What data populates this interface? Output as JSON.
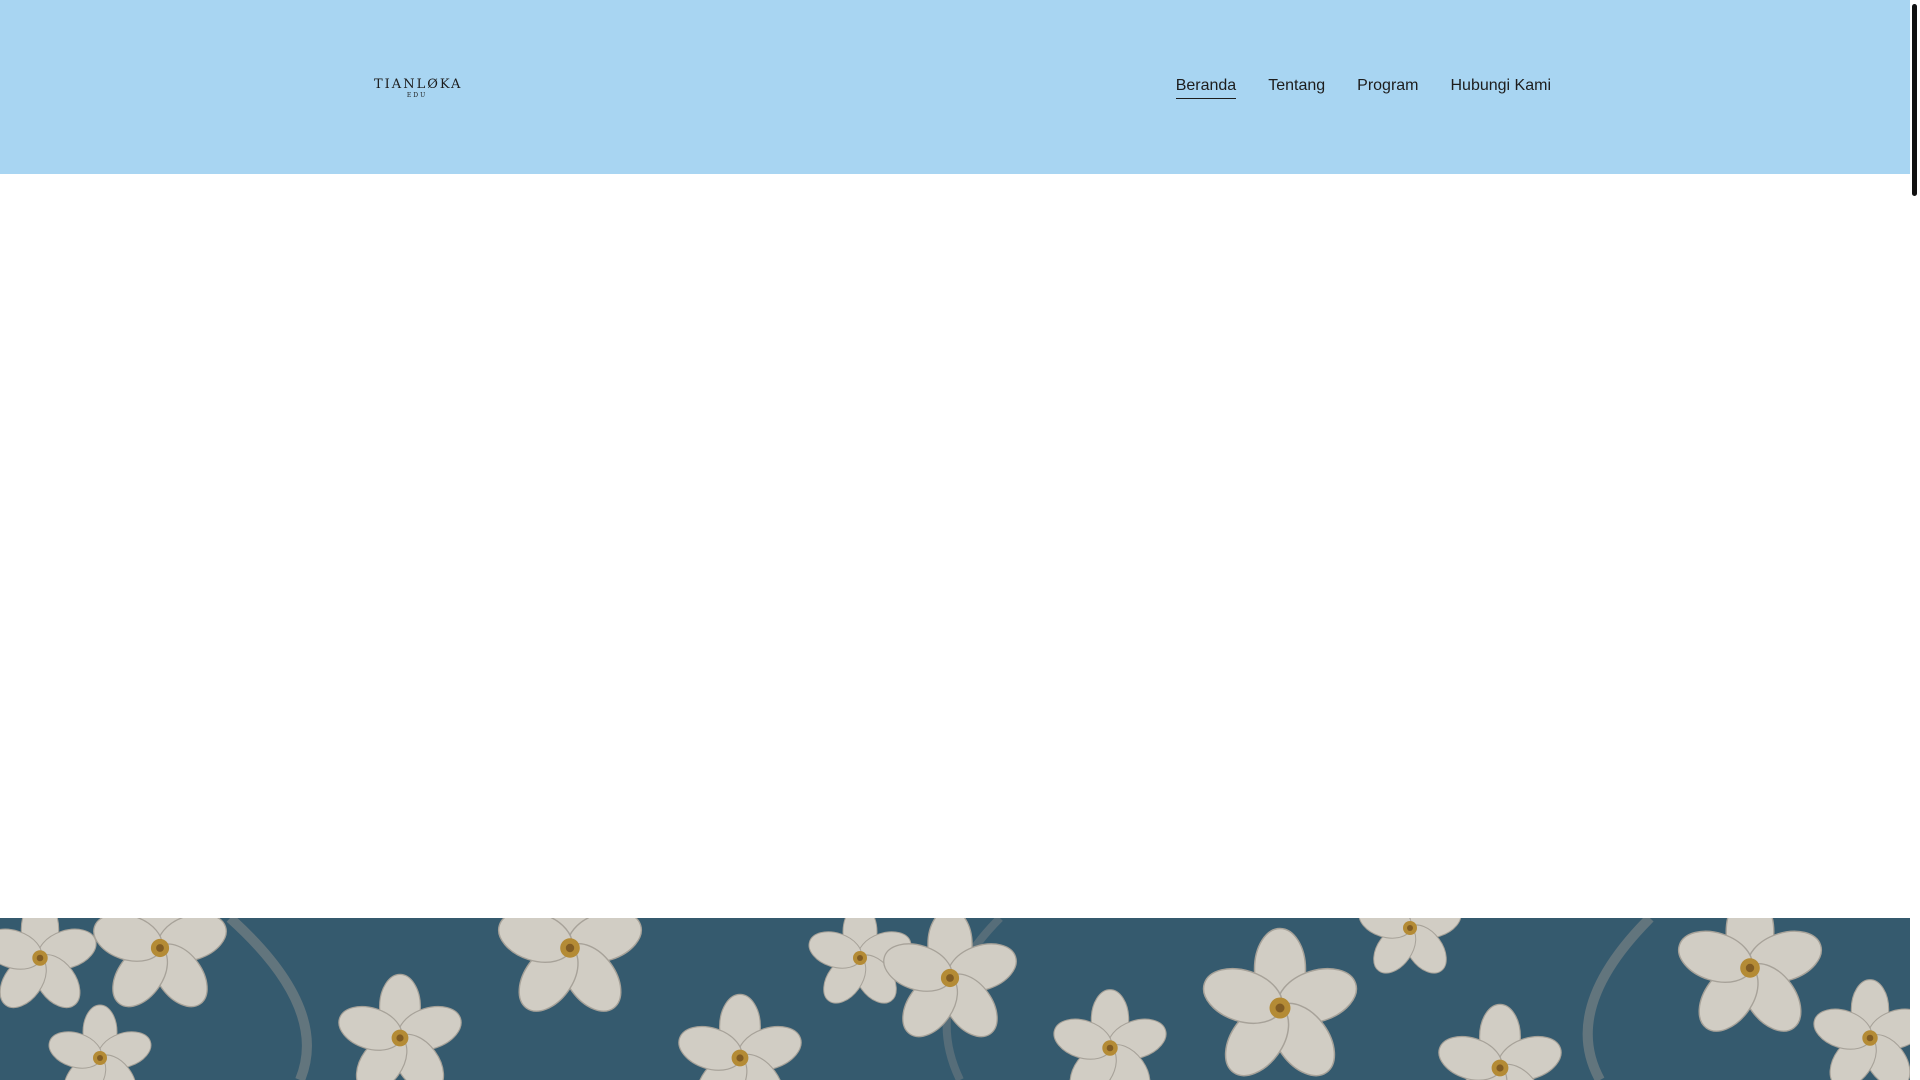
{
  "brand": {
    "logo_main": "TIANLØKA",
    "logo_sub": "EDU"
  },
  "nav": {
    "items": [
      {
        "label": "Beranda",
        "active": true
      },
      {
        "label": "Tentang",
        "active": false
      },
      {
        "label": "Program",
        "active": false
      },
      {
        "label": "Hubungi Kami",
        "active": false
      }
    ]
  },
  "colors": {
    "header_bg": "#a8d5f2",
    "text": "#1d1d1d",
    "banner_bg": "#2e5b73",
    "petal": "#ece7dc",
    "flower_center": "#c9962e"
  },
  "banner": {
    "image_name": "white-flowers-pattern-image"
  }
}
